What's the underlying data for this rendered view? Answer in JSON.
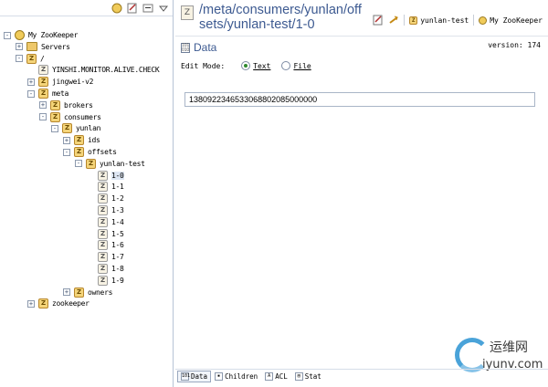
{
  "toolbar_icons": [
    "connect-icon",
    "edit-icon",
    "collapse-icon",
    "view-menu-icon"
  ],
  "tree": [
    {
      "label": "My ZooKeeper",
      "depth": 0,
      "expander": "-",
      "icon": "root",
      "name": "my-zookeeper"
    },
    {
      "label": "Servers",
      "depth": 1,
      "expander": "+",
      "icon": "folder",
      "name": "servers"
    },
    {
      "label": "/",
      "depth": 1,
      "expander": "-",
      "icon": "z",
      "name": "root-slash"
    },
    {
      "label": "YINSHI.MONITOR.ALIVE.CHECK",
      "depth": 2,
      "expander": "",
      "icon": "leaf",
      "name": "yinshi-monitor"
    },
    {
      "label": "jingwei-v2",
      "depth": 2,
      "expander": "+",
      "icon": "z",
      "name": "jingwei-v2"
    },
    {
      "label": "meta",
      "depth": 2,
      "expander": "-",
      "icon": "z",
      "name": "meta"
    },
    {
      "label": "brokers",
      "depth": 3,
      "expander": "+",
      "icon": "z",
      "name": "brokers"
    },
    {
      "label": "consumers",
      "depth": 3,
      "expander": "-",
      "icon": "z",
      "name": "consumers"
    },
    {
      "label": "yunlan",
      "depth": 4,
      "expander": "-",
      "icon": "z",
      "name": "yunlan"
    },
    {
      "label": "ids",
      "depth": 5,
      "expander": "+",
      "icon": "z",
      "name": "ids"
    },
    {
      "label": "offsets",
      "depth": 5,
      "expander": "-",
      "icon": "z",
      "name": "offsets"
    },
    {
      "label": "yunlan-test",
      "depth": 6,
      "expander": "-",
      "icon": "z",
      "name": "yunlan-test"
    },
    {
      "label": "1-0",
      "depth": 7,
      "expander": "",
      "icon": "leaf",
      "name": "1-0",
      "selected": true
    },
    {
      "label": "1-1",
      "depth": 7,
      "expander": "",
      "icon": "leaf",
      "name": "1-1"
    },
    {
      "label": "1-2",
      "depth": 7,
      "expander": "",
      "icon": "leaf",
      "name": "1-2"
    },
    {
      "label": "1-3",
      "depth": 7,
      "expander": "",
      "icon": "leaf",
      "name": "1-3"
    },
    {
      "label": "1-4",
      "depth": 7,
      "expander": "",
      "icon": "leaf",
      "name": "1-4"
    },
    {
      "label": "1-5",
      "depth": 7,
      "expander": "",
      "icon": "leaf",
      "name": "1-5"
    },
    {
      "label": "1-6",
      "depth": 7,
      "expander": "",
      "icon": "leaf",
      "name": "1-6"
    },
    {
      "label": "1-7",
      "depth": 7,
      "expander": "",
      "icon": "leaf",
      "name": "1-7"
    },
    {
      "label": "1-8",
      "depth": 7,
      "expander": "",
      "icon": "leaf",
      "name": "1-8"
    },
    {
      "label": "1-9",
      "depth": 7,
      "expander": "",
      "icon": "leaf",
      "name": "1-9"
    },
    {
      "label": "owners",
      "depth": 5,
      "expander": "+",
      "icon": "z",
      "name": "owners"
    },
    {
      "label": "zookeeper",
      "depth": 2,
      "expander": "+",
      "icon": "z",
      "name": "zookeeper"
    }
  ],
  "editor": {
    "path": "/meta/consumers/yunlan/offsets/yunlan-test/1-0",
    "crumbs": [
      "yunlan-test",
      "My ZooKeeper"
    ],
    "section_title": "Data",
    "version": "version: 174",
    "edit_mode_label": "Edit Mode:",
    "mode_text": "Text",
    "mode_file": "File",
    "data_value": "1380922346533068802085000000"
  },
  "tabs": [
    {
      "label": "Data",
      "active": true,
      "name": "tab-data"
    },
    {
      "label": "Children",
      "active": false,
      "name": "tab-children"
    },
    {
      "label": "ACL",
      "active": false,
      "name": "tab-acl"
    },
    {
      "label": "Stat",
      "active": false,
      "name": "tab-stat"
    }
  ],
  "watermark": {
    "cn": "运维网",
    "en": "iyunv.com"
  }
}
